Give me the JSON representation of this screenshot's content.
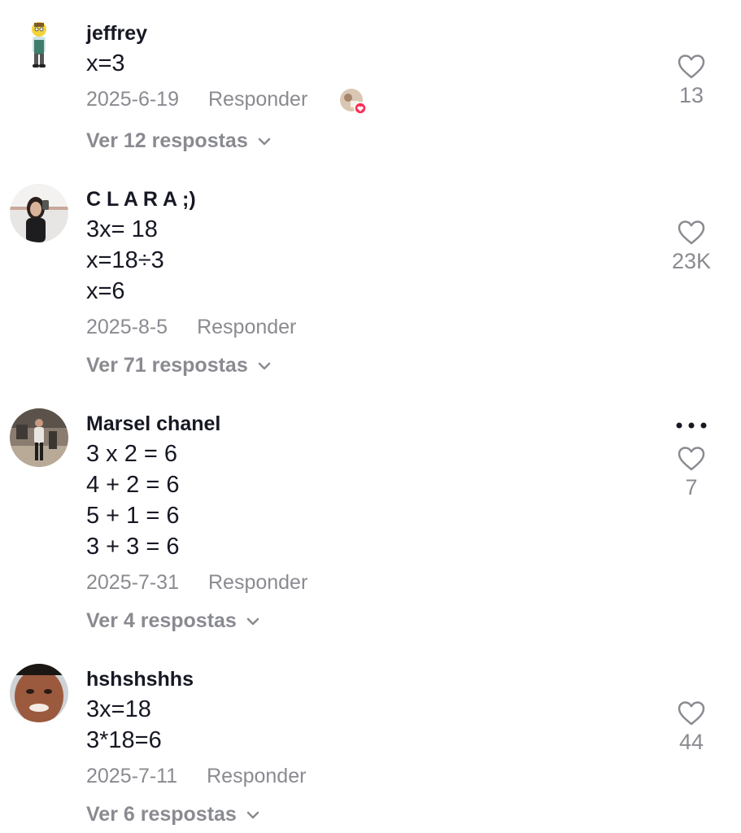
{
  "comments": [
    {
      "username": "jeffrey",
      "lines": [
        "x=3"
      ],
      "date": "2025-6-19",
      "reply_label": "Responder",
      "likes": "13",
      "view_replies": "Ver 12 respostas",
      "avatar_icon": "cartoon-character-icon",
      "liked_by_creator": true
    },
    {
      "username": "C L A R A ;)",
      "lines": [
        "3x= 18",
        "x=18÷3",
        "x=6"
      ],
      "date": "2025-8-5",
      "reply_label": "Responder",
      "likes": "23K",
      "view_replies": "Ver 71 respostas",
      "avatar_icon": "user-photo"
    },
    {
      "username": "Marsel chanel",
      "lines": [
        "3 x 2 = 6",
        "4 + 2 = 6",
        "5 + 1 = 6",
        "3 + 3 = 6"
      ],
      "date": "2025-7-31",
      "reply_label": "Responder",
      "likes": "7",
      "view_replies": "Ver 4 respostas",
      "avatar_icon": "user-photo",
      "more_icon": "more-options-icon"
    },
    {
      "username": "hshshshhs",
      "lines": [
        "3x=18",
        "3*18=6"
      ],
      "date": "2025-7-11",
      "reply_label": "Responder",
      "likes": "44",
      "view_replies": "Ver 6 respostas",
      "avatar_icon": "user-photo"
    }
  ],
  "colors": {
    "primary_text": "#161823",
    "secondary_text": "#8a8b91",
    "creator_badge": "#fe2c55"
  }
}
